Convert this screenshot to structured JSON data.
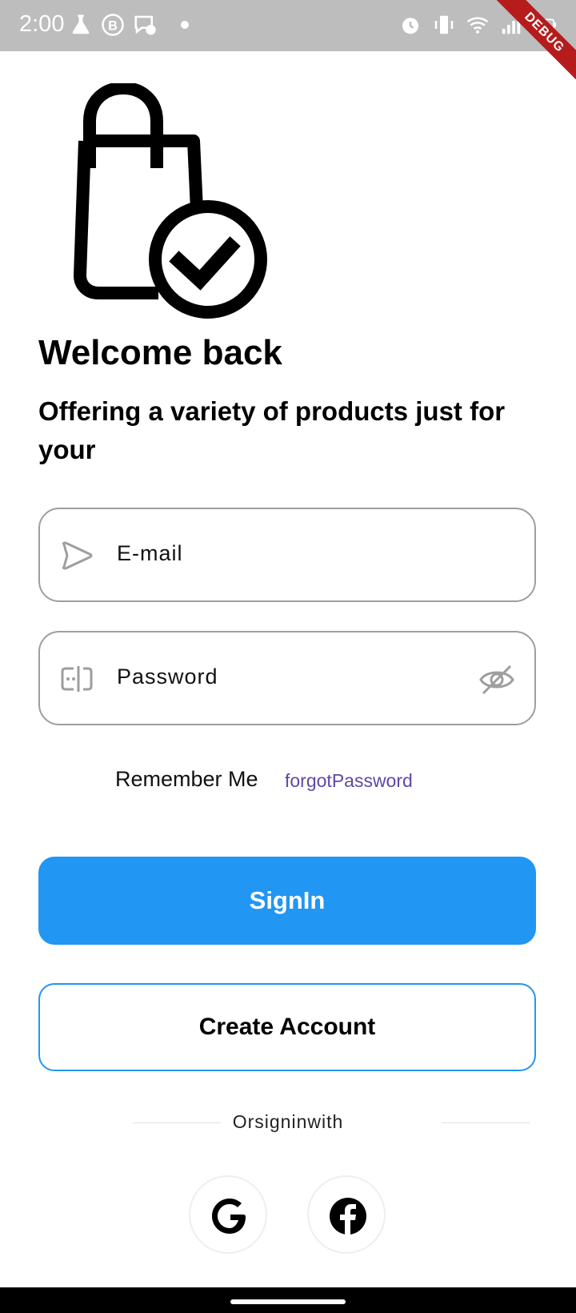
{
  "status_bar": {
    "time": "2:00",
    "icons_left": [
      "flask-icon",
      "b-badge-icon",
      "messenger-icon",
      "dot-icon"
    ],
    "icons_right": [
      "alarm-icon",
      "vibrate-icon",
      "wifi-icon",
      "signal-icon",
      "battery-icon"
    ],
    "battery_level": "4",
    "debug_label": "DEBUG"
  },
  "login": {
    "welcome": "Welcome back",
    "subtitle": "Offering a variety of products just for your",
    "email_placeholder": "E-mail",
    "password_placeholder": "Password",
    "remember_me": "Remember Me",
    "forgot_password": "forgotPassword",
    "signin_label": "SignIn",
    "create_account_label": "Create Account",
    "divider_text": "Orsigninwith"
  },
  "colors": {
    "primary": "#2196f3",
    "link": "#5e48a8",
    "field_border": "#9e9e9e",
    "status_bar": "#bdbdbd"
  }
}
